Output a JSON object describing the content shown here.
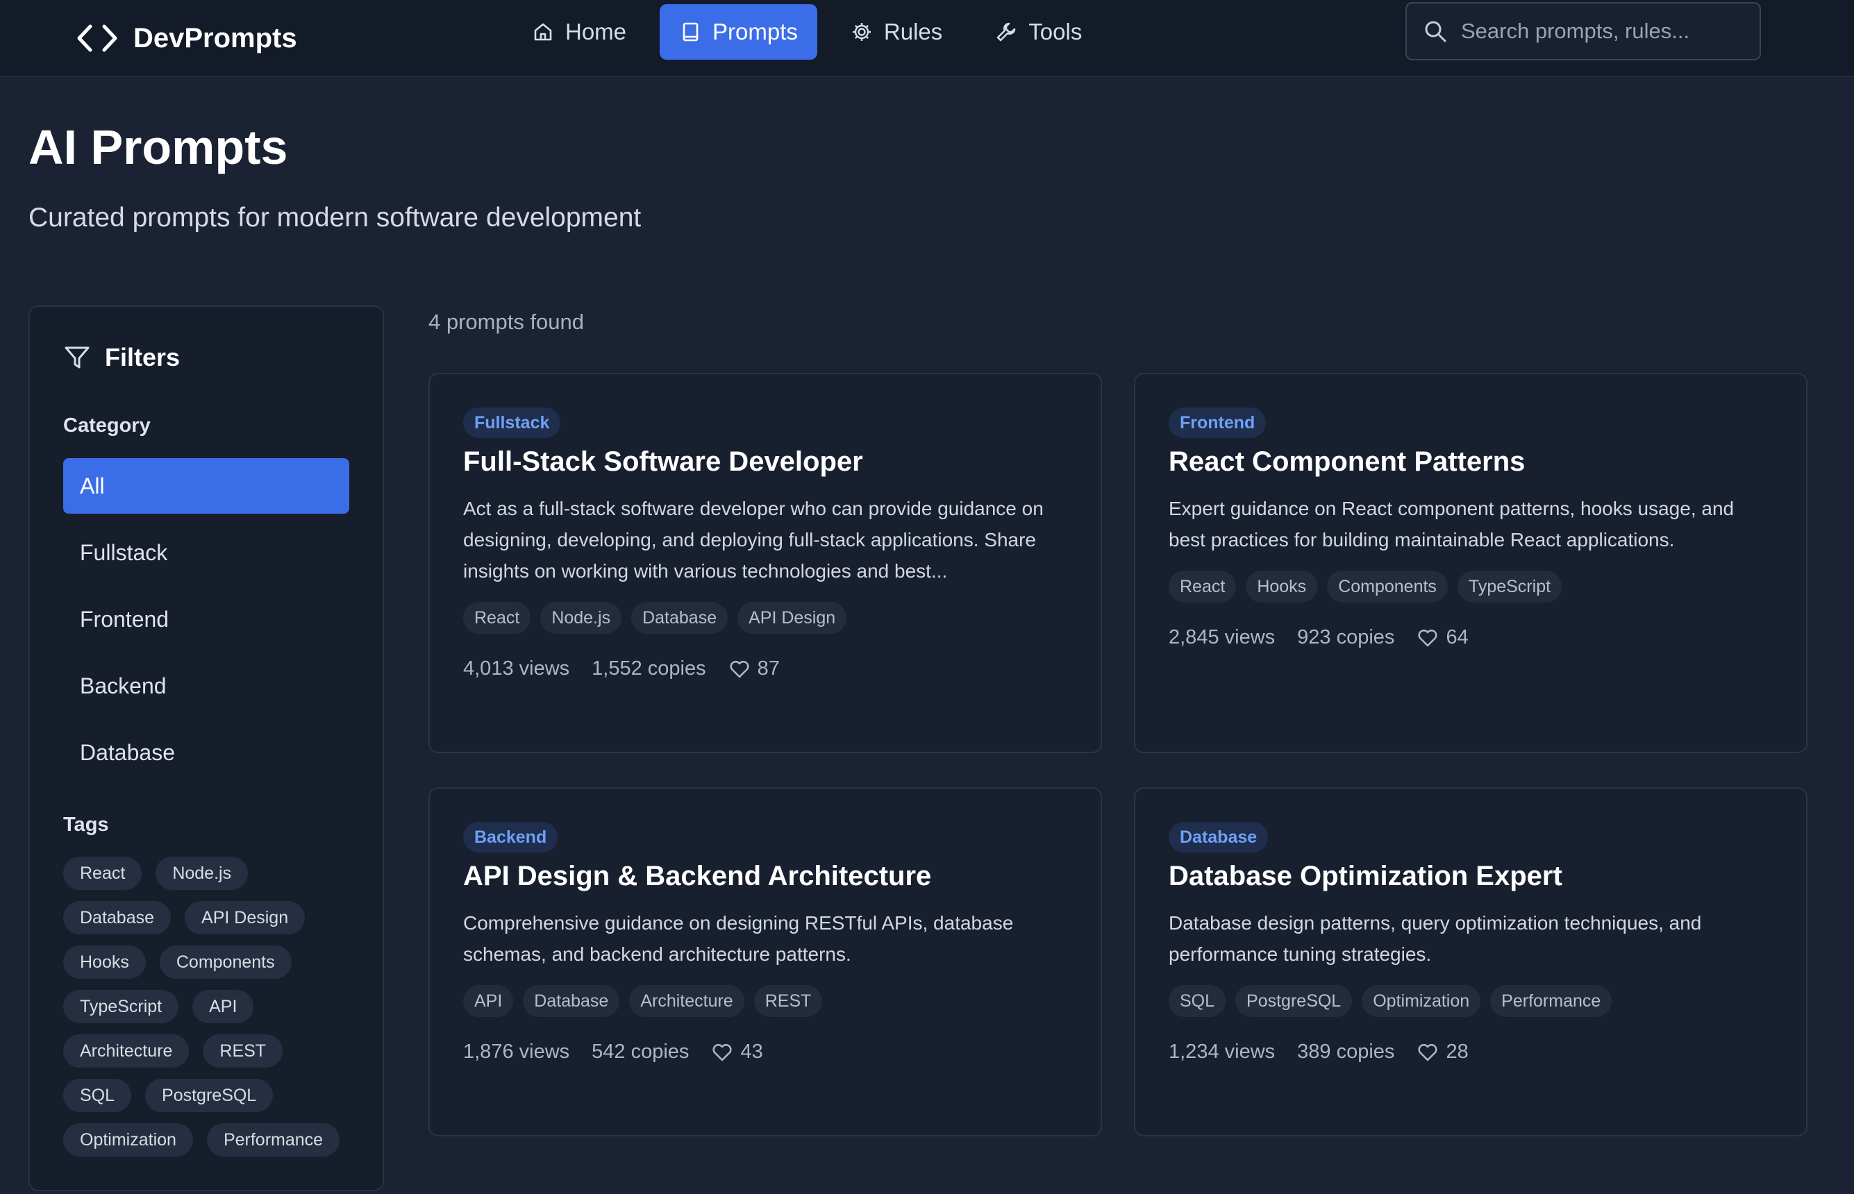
{
  "header": {
    "brand": "DevPrompts",
    "nav": [
      {
        "label": "Home",
        "icon": "home-icon"
      },
      {
        "label": "Prompts",
        "icon": "book-icon",
        "active": true
      },
      {
        "label": "Rules",
        "icon": "gear-icon"
      },
      {
        "label": "Tools",
        "icon": "wrench-icon"
      }
    ],
    "search_placeholder": "Search prompts, rules..."
  },
  "page": {
    "title": "AI Prompts",
    "subtitle": "Curated prompts for modern software development"
  },
  "filters": {
    "title": "Filters",
    "category_label": "Category",
    "categories": [
      "All",
      "Fullstack",
      "Frontend",
      "Backend",
      "Database"
    ],
    "active_category": "All",
    "tags_label": "Tags",
    "tags": [
      "React",
      "Node.js",
      "Database",
      "API Design",
      "Hooks",
      "Components",
      "TypeScript",
      "API",
      "Architecture",
      "REST",
      "SQL",
      "PostgreSQL",
      "Optimization",
      "Performance"
    ]
  },
  "results": {
    "count_text": "4 prompts found",
    "cards": [
      {
        "category": "Fullstack",
        "title": "Full-Stack Software Developer",
        "description": "Act as a full-stack software developer who can provide guidance on designing, developing, and deploying full-stack applications. Share insights on working with various technologies and best...",
        "tags": [
          "React",
          "Node.js",
          "Database",
          "API Design"
        ],
        "views": "4,013 views",
        "copies": "1,552 copies",
        "likes": "87"
      },
      {
        "category": "Frontend",
        "title": "React Component Patterns",
        "description": "Expert guidance on React component patterns, hooks usage, and best practices for building maintainable React applications.",
        "tags": [
          "React",
          "Hooks",
          "Components",
          "TypeScript"
        ],
        "views": "2,845 views",
        "copies": "923 copies",
        "likes": "64"
      },
      {
        "category": "Backend",
        "title": "API Design & Backend Architecture",
        "description": "Comprehensive guidance on designing RESTful APIs, database schemas, and backend architecture patterns.",
        "tags": [
          "API",
          "Database",
          "Architecture",
          "REST"
        ],
        "views": "1,876 views",
        "copies": "542 copies",
        "likes": "43"
      },
      {
        "category": "Database",
        "title": "Database Optimization Expert",
        "description": "Database design patterns, query optimization techniques, and performance tuning strategies.",
        "tags": [
          "SQL",
          "PostgreSQL",
          "Optimization",
          "Performance"
        ],
        "views": "1,234 views",
        "copies": "389 copies",
        "likes": "28"
      }
    ]
  },
  "colors": {
    "background": "#1b2233",
    "topbar": "#131a28",
    "accent": "#3c6de8",
    "badge_text": "#6fa0f5"
  }
}
